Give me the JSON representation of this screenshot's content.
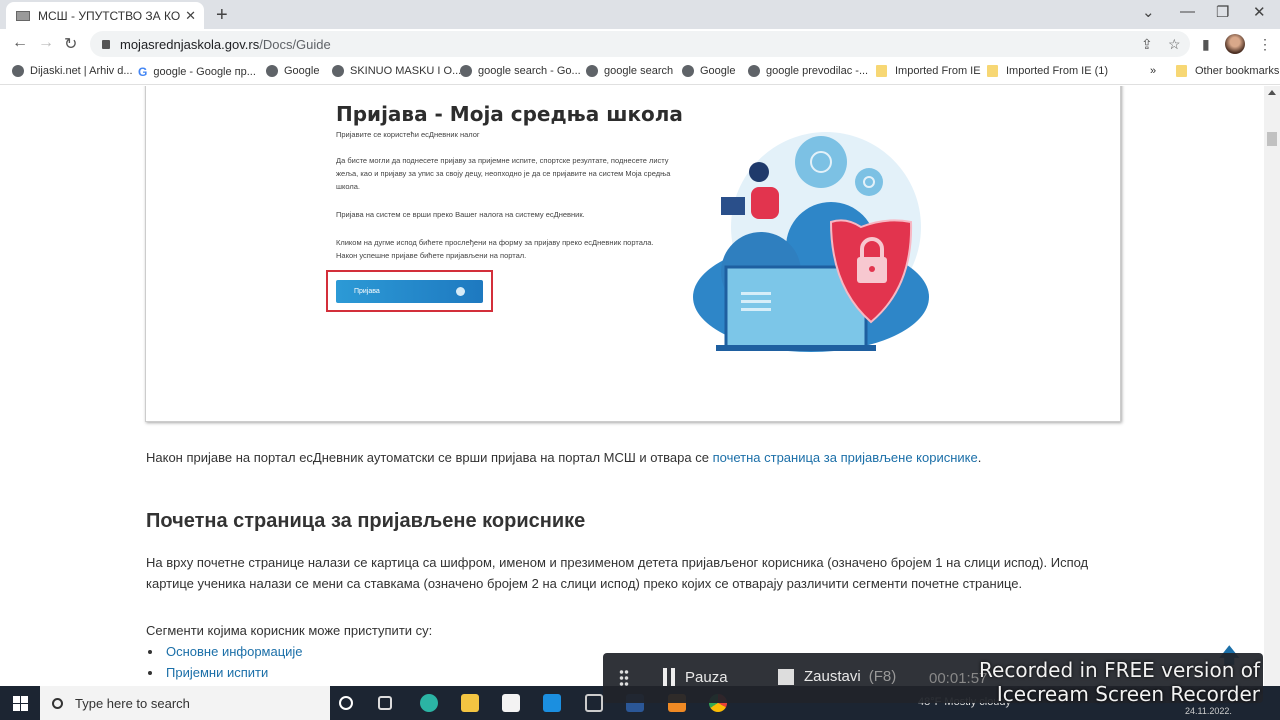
{
  "browser": {
    "tab_title": "МСШ - УПУТСТВО ЗА КОРИШЋЕ",
    "favicon_text": "МСШ",
    "url_domain": "mojasrednjaskola.gov.rs",
    "url_path": "/Docs/Guide",
    "bookmarks": [
      {
        "label": "Dijaski.net | Arhiv d...",
        "icon": "globe-icon"
      },
      {
        "label": "google - Google пр...",
        "icon": "google-icon"
      },
      {
        "label": "Google",
        "icon": "globe-icon"
      },
      {
        "label": "SKINUO MASKU I O...",
        "icon": "globe-icon"
      },
      {
        "label": "google search - Go...",
        "icon": "globe-icon"
      },
      {
        "label": "google search",
        "icon": "globe-icon"
      },
      {
        "label": "Google",
        "icon": "globe-icon"
      },
      {
        "label": "google prevodilac -...",
        "icon": "globe-icon"
      },
      {
        "label": "Imported From IE",
        "icon": "folder-icon"
      },
      {
        "label": "Imported From IE (1)",
        "icon": "folder-icon"
      }
    ],
    "overflow": "»",
    "other_bookmarks": "Other bookmarks"
  },
  "embedded_screenshot": {
    "title": "Пријава - Моја средња школа",
    "p1": "Пријавите се користећи есДневник налог",
    "p2": "Да бисте могли да поднесете пријаву за пријемне испите, спортске резултате, поднесете листу жеља, као и пријаву за упис за своју децу, неопходно је да се пријавите на систем Моја средња школа.",
    "p3": "Пријава на систем се врши преко Вашег налога на систему есДневник.",
    "p4": "Кликом на дугме испод бићете прослеђени на форму за пријаву преко есДневник портала. Након успешне пријаве бићете пријављени на портал.",
    "button_label": "Пријава"
  },
  "content": {
    "para1_text": "Након пријаве на портал есДневник аутоматски се врши пријава на портал МСШ и отвара се ",
    "para1_link": "почетна страница за пријављене кориснике",
    "para1_end": ".",
    "heading": "Почетна страница за пријављене кориснике",
    "para2": "На врху почетне странице налази се картица са шифром, именом и презименом детета пријављеног корисника (означено бројем 1 на слици испод). Испод картице ученика налази се мени са ставкама (означено бројем 2 на слици испод) преко којих се отварају различити сегменти почетне странице.",
    "para3": "Сегменти којима корисник може приступити су:",
    "list": [
      "Основне информације",
      "Пријемни испити"
    ]
  },
  "taskbar": {
    "search_placeholder": "Type here to search",
    "weather": "48°F  Mostly cloudy",
    "date": "24.11.2022."
  },
  "recorder": {
    "pause_label": "Pauza",
    "stop_label": "Zaustavi",
    "stop_hotkey": "(F8)",
    "elapsed": "00:01:57",
    "watermark_line1": "Recorded in FREE version of",
    "watermark_line2": "Icecream  Screen  Recorder"
  },
  "colors": {
    "link": "#1b6fa8",
    "highlight_frame": "#d32f3a",
    "button": "#2c9ad6"
  }
}
